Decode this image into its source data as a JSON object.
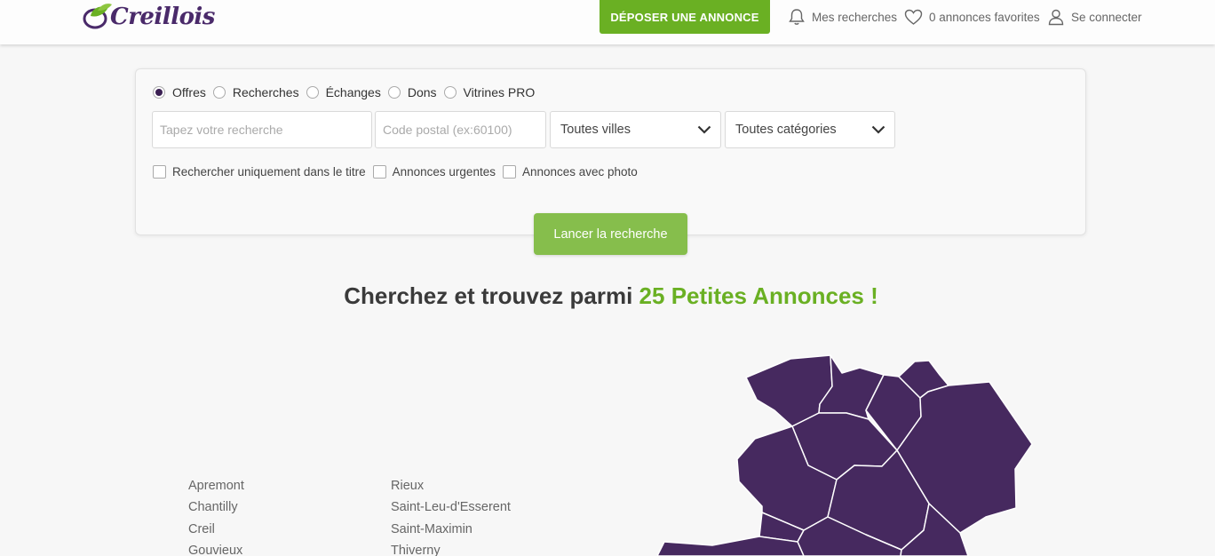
{
  "header": {
    "logo_text": "Creillois",
    "deposit_button": "DÉPOSER UNE ANNONCE",
    "my_searches": "Mes recherches",
    "favorites": "0 annonces favorites",
    "login": "Se connecter"
  },
  "search": {
    "types": [
      {
        "label": "Offres",
        "checked": true
      },
      {
        "label": "Recherches",
        "checked": false
      },
      {
        "label": "Échanges",
        "checked": false
      },
      {
        "label": "Dons",
        "checked": false
      },
      {
        "label": "Vitrines PRO",
        "checked": false
      }
    ],
    "query_placeholder": "Tapez votre recherche",
    "postal_placeholder": "Code postal (ex:60100)",
    "city_select": "Toutes villes",
    "category_select": "Toutes catégories",
    "options": [
      "Rechercher uniquement dans le titre",
      "Annonces urgentes",
      "Annonces avec photo"
    ],
    "submit": "Lancer la recherche"
  },
  "headline": {
    "prefix": "Cherchez et trouvez parmi",
    "highlight": "25 Petites Annonces !"
  },
  "cities": {
    "col1": [
      "Apremont",
      "Chantilly",
      "Creil",
      "Gouvieux"
    ],
    "col2": [
      "Rieux",
      "Saint-Leu-d'Esserent",
      "Saint-Maximin",
      "Thiverny"
    ]
  },
  "colors": {
    "accent": "#6ab023",
    "brand": "#4a2a6a",
    "map_fill": "#46295f"
  },
  "icons": {
    "bell": "bell-icon",
    "heart": "heart-icon",
    "user": "user-icon",
    "chevron": "chevron-down-icon",
    "logo_mark": "leaf-logo-icon"
  }
}
